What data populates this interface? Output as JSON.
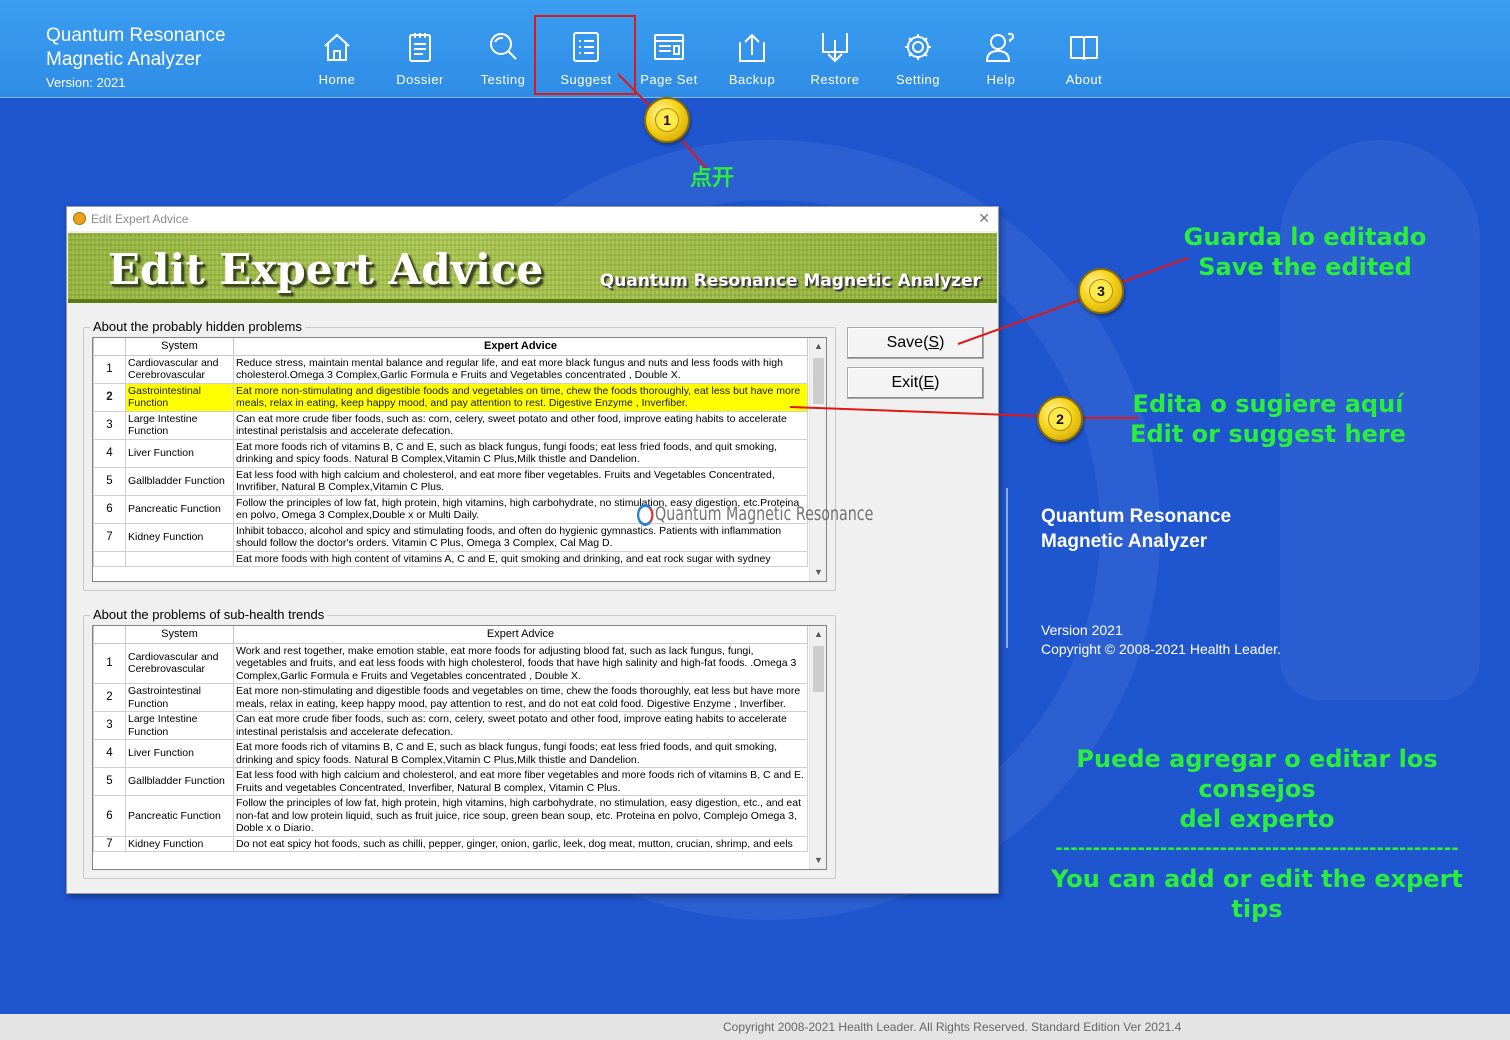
{
  "app": {
    "title_line1": "Quantum Resonance",
    "title_line2": "Magnetic Analyzer",
    "version": "Version: 2021"
  },
  "nav": [
    {
      "label": "Home",
      "icon": "home-icon"
    },
    {
      "label": "Dossier",
      "icon": "document-icon"
    },
    {
      "label": "Testing",
      "icon": "magnifier-icon"
    },
    {
      "label": "Suggest",
      "icon": "list-icon"
    },
    {
      "label": "Page Set",
      "icon": "page-set-icon"
    },
    {
      "label": "Backup",
      "icon": "upload-icon"
    },
    {
      "label": "Restore",
      "icon": "download-icon"
    },
    {
      "label": "Setting",
      "icon": "gear-icon"
    },
    {
      "label": "Help",
      "icon": "user-help-icon"
    },
    {
      "label": "About",
      "icon": "book-icon"
    }
  ],
  "annotations": {
    "bubble1": "1",
    "bubble2": "2",
    "bubble3": "3",
    "click_text": "点开",
    "save_es": "Guarda lo editado",
    "save_en": "Save the edited",
    "edit_es": "Edita o sugiere aquí",
    "edit_en": "Edit or suggest here",
    "tip_es_1": "Puede agregar o editar los consejos",
    "tip_es_2": "del experto",
    "tip_sep": "------------------------------------------------------",
    "tip_en": "You can add or edit the expert tips"
  },
  "right_info": {
    "title1": "Quantum Resonance",
    "title2": "Magnetic Analyzer",
    "version": "Version 2021",
    "copyright": "Copyright © 2008-2021 Health Leader."
  },
  "dialog": {
    "title": "Edit Expert Advice",
    "banner_title": "Edit Expert Advice",
    "banner_sub": "Quantum Resonance Magnetic Analyzer",
    "save_label": "Save(S)",
    "exit_label": "Exit(E)",
    "watermark": "Quantum Magnetic Resonance",
    "hidden": {
      "label": "About the probably hidden problems",
      "col_system": "System",
      "col_advice": "Expert Advice",
      "rows": [
        {
          "n": "1",
          "system": "Cardiovascular and Cerebrovascular",
          "advice": "Reduce stress, maintain mental balance and regular life, and eat more black fungus and nuts and less foods with high cholesterol.Omega 3 Complex,Garlic Formula e Fruits and Vegetables concentrated , Double X."
        },
        {
          "n": "2",
          "system": "Gastrointestinal Function",
          "advice": "Eat more non-stimulating and digestible foods and vegetables on time, chew the foods thoroughly, eat less but have more meals, relax in eating, keep happy mood, and pay attention to rest. Digestive Enzyme , Inverfiber."
        },
        {
          "n": "3",
          "system": "Large Intestine Function",
          "advice": "Can eat more crude fiber foods, such as: corn, celery, sweet potato and other food, improve eating habits to accelerate intestinal peristalsis and accelerate defecation."
        },
        {
          "n": "4",
          "system": "Liver Function",
          "advice": "Eat more foods rich of vitamins B, C and E, such as black fungus, fungi foods; eat less fried foods, and quit smoking, drinking and spicy foods. Natural B Complex,Vitamin C Plus,Milk thistle and Dandelion."
        },
        {
          "n": "5",
          "system": "Gallbladder Function",
          "advice": "Eat less food with high calcium and cholesterol, and eat more fiber vegetables. Fruits and Vegetables Concentrated, Invrifiber, Natural B Complex,Vitamin C Plus."
        },
        {
          "n": "6",
          "system": "Pancreatic Function",
          "advice": "Follow the principles of low fat, high protein, high vitamins, high carbohydrate, no stimulation, easy digestion, etc.Proteina en polvo, Omega 3 Complex,Double x or  Multi Daily."
        },
        {
          "n": "7",
          "system": "Kidney Function",
          "advice": "Inhibit tobacco, alcohol and spicy and stimulating foods, and often do hygienic gymnastics. Patients with inflammation should follow the doctor's orders. Vitamin C Plus, Omega 3 Complex, Cal Mag D."
        },
        {
          "n": "",
          "system": "",
          "advice": "Eat more foods with high content of vitamins A, C and E, quit smoking and drinking, and eat rock sugar with sydney"
        }
      ]
    },
    "subhealth": {
      "label": "About the problems of sub-health trends",
      "col_system": "System",
      "col_advice": "Expert Advice",
      "rows": [
        {
          "n": "1",
          "system": "Cardiovascular and Cerebrovascular",
          "advice": "Work and rest together, make emotion stable, eat more foods for adjusting blood fat, such as lack fungus, fungi, vegetables and fruits, and eat less foods with high cholesterol, foods that have high salinity and high-fat foods. .Omega 3 Complex,Garlic Formula e Fruits and Vegetables concentrated , Double X."
        },
        {
          "n": "2",
          "system": "Gastrointestinal Function",
          "advice": "Eat more non-stimulating and digestible foods and vegetables on time, chew the foods thoroughly, eat less but have more meals, relax in eating, keep happy mood, pay attention to rest, and do not eat cold food.  Digestive Enzyme , Inverfiber."
        },
        {
          "n": "3",
          "system": "Large Intestine Function",
          "advice": "Can eat more crude fiber foods, such as: corn, celery, sweet potato and other food, improve eating habits to accelerate intestinal peristalsis and accelerate defecation."
        },
        {
          "n": "4",
          "system": "Liver Function",
          "advice": "Eat more foods rich of vitamins B, C and E, such as black fungus, fungi foods; eat less fried foods, and quit smoking, drinking and spicy foods. Natural B Complex,Vitamin C Plus,Milk thistle and Dandelion."
        },
        {
          "n": "5",
          "system": "Gallbladder Function",
          "advice": "Eat less food with high calcium and cholesterol, and eat more fiber vegetables and more foods rich of vitamins B, C and E. Fruits and vegetables Concentrated, Inverfiber, Natural B complex, Vitamin C Plus."
        },
        {
          "n": "6",
          "system": "Pancreatic Function",
          "advice": "Follow the principles of low fat, high protein, high vitamins, high carbohydrate, no stimulation, easy digestion, etc., and eat non-fat and low protein liquid, such as fruit juice, rice soup, green bean soup, etc. Proteina en polvo, Complejo Omega 3, Doble x o Diario."
        },
        {
          "n": "7",
          "system": "Kidney Function",
          "advice": "Do not eat spicy hot foods, such as chilli, pepper, ginger, onion, garlic, leek, dog meat, mutton, crucian, shrimp, and eels"
        }
      ]
    }
  },
  "statusbar": "Copyright 2008-2021 Health Leader. All Rights Reserved.  Standard Edition Ver 2021.4"
}
